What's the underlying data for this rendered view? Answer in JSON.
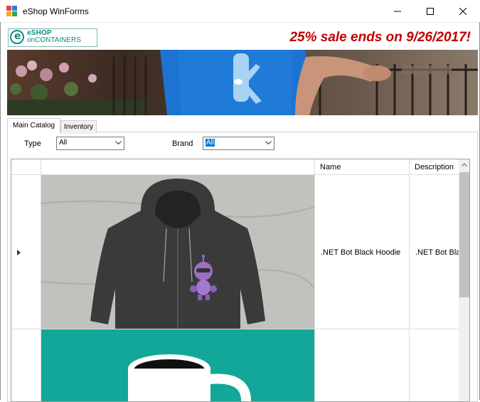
{
  "window": {
    "title": "eShop WinForms"
  },
  "logo": {
    "line1": "eSHOP",
    "line2": "onCONTAINERS",
    "letter": "e"
  },
  "banner": {
    "sale_text": "25% sale ends on 9/26/2017!"
  },
  "tabs": [
    {
      "label": "Main Catalog",
      "selected": true
    },
    {
      "label": "Inventory",
      "selected": false
    }
  ],
  "filters": {
    "type_label": "Type",
    "type_value": "All",
    "brand_label": "Brand",
    "brand_value": "All"
  },
  "grid": {
    "columns": [
      "",
      "",
      "Name",
      "Description"
    ],
    "rows": [
      {
        "image": "hoodie-product-image",
        "name": ".NET Bot Black Hoodie",
        "description": ".NET Bot Bla",
        "current": true
      },
      {
        "image": "mug-product-image",
        "name": "",
        "description": "",
        "current": false
      }
    ]
  },
  "colors": {
    "sale_red": "#c00000",
    "brand_teal": "#0f8c7c",
    "selection_blue": "#0078d7"
  }
}
